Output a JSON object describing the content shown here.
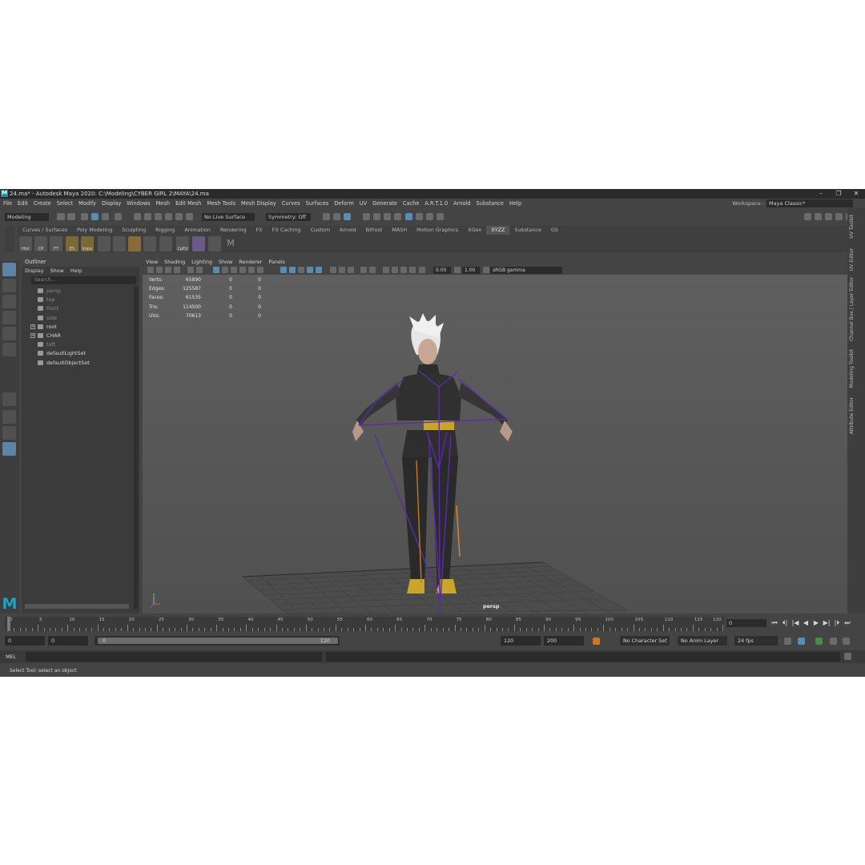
{
  "window": {
    "title": "24.ma* - Autodesk Maya 2020: C:\\Modeling\\CYBER GIRL 2\\MAYA\\24.ma",
    "app_icon": "M",
    "controls": [
      "–",
      "❐",
      "✕"
    ]
  },
  "menubar": {
    "items": [
      "File",
      "Edit",
      "Create",
      "Select",
      "Modify",
      "Display",
      "Windows",
      "Mesh",
      "Edit Mesh",
      "Mesh Tools",
      "Mesh Display",
      "Curves",
      "Surfaces",
      "Deform",
      "UV",
      "Generate",
      "Cache",
      "A.R.T.1.0",
      "Arnold",
      "Substance",
      "Help"
    ],
    "workspace_label": "Workspace :",
    "workspace_value": "Maya Classic*"
  },
  "statusline": {
    "mode": "Modeling",
    "live_surface": "No Live Surface",
    "symmetry": "Symmetry: Off"
  },
  "shelf": {
    "tabs": [
      "Curves / Surfaces",
      "Poly Modeling",
      "Sculpting",
      "Rigging",
      "Animation",
      "Rendering",
      "FX",
      "FX Caching",
      "Custom",
      "Arnold",
      "Bifrost",
      "MASH",
      "Motion Graphics",
      "XGen",
      "XYZZ",
      "Substance",
      "GS"
    ],
    "active_tab": "XYZZ",
    "buttons": [
      "Hist",
      "CP",
      "FT",
      "ES",
      "Impo",
      "",
      "",
      "",
      "",
      "CpEd",
      "",
      "",
      ""
    ]
  },
  "outliner": {
    "title": "Outliner",
    "menu": [
      "Display",
      "Show",
      "Help"
    ],
    "search_placeholder": "Search...",
    "items": [
      {
        "label": "persp",
        "dim": true,
        "expand": false
      },
      {
        "label": "top",
        "dim": true,
        "expand": false
      },
      {
        "label": "front",
        "dim": true,
        "expand": false
      },
      {
        "label": "side",
        "dim": true,
        "expand": false
      },
      {
        "label": "root",
        "dim": false,
        "expand": true
      },
      {
        "label": "CHAR",
        "dim": false,
        "expand": true
      },
      {
        "label": "taft",
        "dim": true,
        "expand": false
      },
      {
        "label": "defaultLightSet",
        "dim": false,
        "expand": false
      },
      {
        "label": "defaultObjectSet",
        "dim": false,
        "expand": false
      }
    ]
  },
  "panel": {
    "menu": [
      "View",
      "Shading",
      "Lighting",
      "Show",
      "Renderer",
      "Panels"
    ],
    "exposure": "0.00",
    "gamma": "1.00",
    "colorspace": "sRGB gamma",
    "camera": "persp"
  },
  "hud": {
    "rows": [
      {
        "label": "Verts:",
        "v1": "65890",
        "v2": "0",
        "v3": "0"
      },
      {
        "label": "Edges:",
        "v1": "125587",
        "v2": "0",
        "v3": "0"
      },
      {
        "label": "Faces:",
        "v1": "61535",
        "v2": "0",
        "v3": "0"
      },
      {
        "label": "Tris:",
        "v1": "114500",
        "v2": "0",
        "v3": "0"
      },
      {
        "label": "UVs:",
        "v1": "70613",
        "v2": "0",
        "v3": "0"
      }
    ]
  },
  "right_tabs": [
    "UV Toolkit",
    "UV Editor",
    "Channel Box / Layer Editor",
    "Modeling Toolkit",
    "Attribute Editor"
  ],
  "timeslider": {
    "ticks": [
      "0",
      "5",
      "10",
      "15",
      "20",
      "25",
      "30",
      "35",
      "40",
      "45",
      "50",
      "55",
      "60",
      "65",
      "70",
      "75",
      "80",
      "85",
      "90",
      "95",
      "100",
      "105",
      "110",
      "115",
      "120"
    ],
    "current_frame": "0",
    "playback": [
      "⏮",
      "⏴|",
      "|◀",
      "◀",
      "▶",
      "▶|",
      "|⏵",
      "⏭"
    ]
  },
  "range": {
    "start": "0",
    "inner_start": "0",
    "handle_start": "0",
    "handle_end": "120",
    "end": "120",
    "anim_end": "200",
    "character_set": "No Character Set",
    "anim_layer": "No Anim Layer",
    "fps": "24 fps"
  },
  "cmdline": {
    "label": "MEL"
  },
  "helpline": {
    "text": "Select Tool: select an object"
  }
}
